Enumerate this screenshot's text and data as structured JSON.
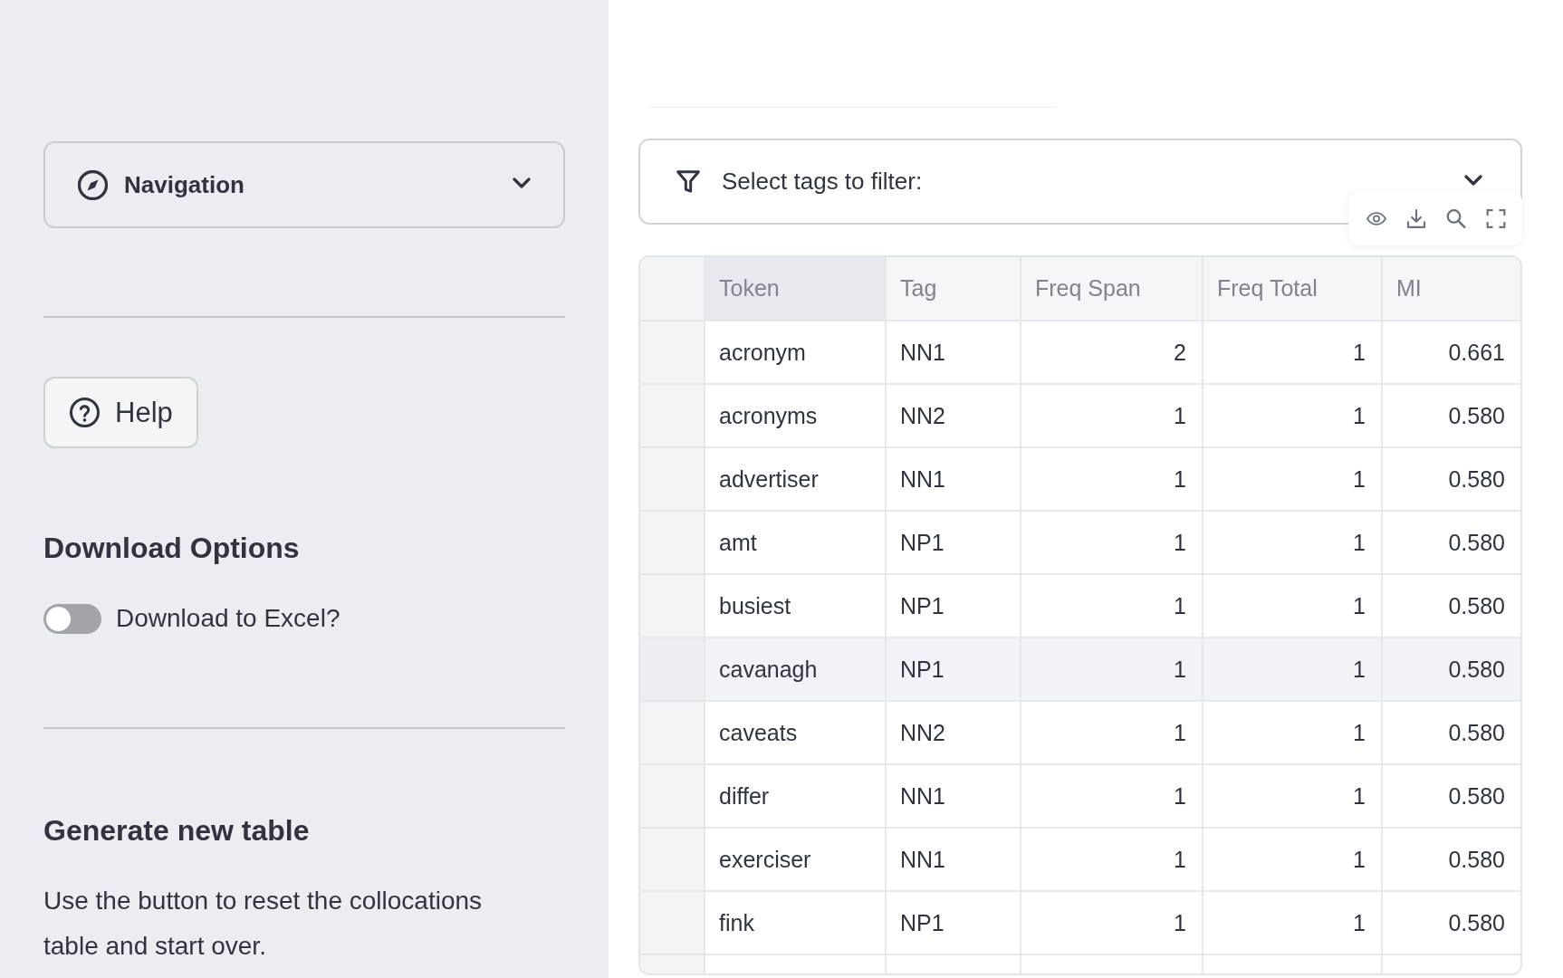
{
  "sidebar": {
    "navigation": {
      "label": "Navigation",
      "expanded": false
    },
    "help_button": {
      "label": "Help"
    },
    "download_options": {
      "heading": "Download Options",
      "toggle": {
        "label": "Download to Excel?",
        "on": false
      }
    },
    "generate": {
      "heading": "Generate new table",
      "text": "Use the button to reset the collocations table and start over."
    }
  },
  "filter": {
    "label": "Select tags to filter:",
    "expanded": false
  },
  "table": {
    "columns": [
      {
        "label": "Token",
        "kind": "text",
        "selected": true
      },
      {
        "label": "Tag",
        "kind": "text",
        "selected": false
      },
      {
        "label": "Freq Span",
        "kind": "number",
        "selected": false
      },
      {
        "label": "Freq Total",
        "kind": "number",
        "selected": false
      },
      {
        "label": "MI",
        "kind": "number",
        "selected": false
      }
    ],
    "rows": [
      {
        "cells": [
          "acronym",
          "NN1",
          "2",
          "1",
          "0.661"
        ],
        "highlighted": false
      },
      {
        "cells": [
          "acronyms",
          "NN2",
          "1",
          "1",
          "0.580"
        ],
        "highlighted": false
      },
      {
        "cells": [
          "advertiser",
          "NN1",
          "1",
          "1",
          "0.580"
        ],
        "highlighted": false
      },
      {
        "cells": [
          "amt",
          "NP1",
          "1",
          "1",
          "0.580"
        ],
        "highlighted": false
      },
      {
        "cells": [
          "busiest",
          "NP1",
          "1",
          "1",
          "0.580"
        ],
        "highlighted": false
      },
      {
        "cells": [
          "cavanagh",
          "NP1",
          "1",
          "1",
          "0.580"
        ],
        "highlighted": true
      },
      {
        "cells": [
          "caveats",
          "NN2",
          "1",
          "1",
          "0.580"
        ],
        "highlighted": false
      },
      {
        "cells": [
          "differ",
          "NN1",
          "1",
          "1",
          "0.580"
        ],
        "highlighted": false
      },
      {
        "cells": [
          "exerciser",
          "NN1",
          "1",
          "1",
          "0.580"
        ],
        "highlighted": false
      },
      {
        "cells": [
          "fink",
          "NP1",
          "1",
          "1",
          "0.580"
        ],
        "highlighted": false
      }
    ]
  }
}
